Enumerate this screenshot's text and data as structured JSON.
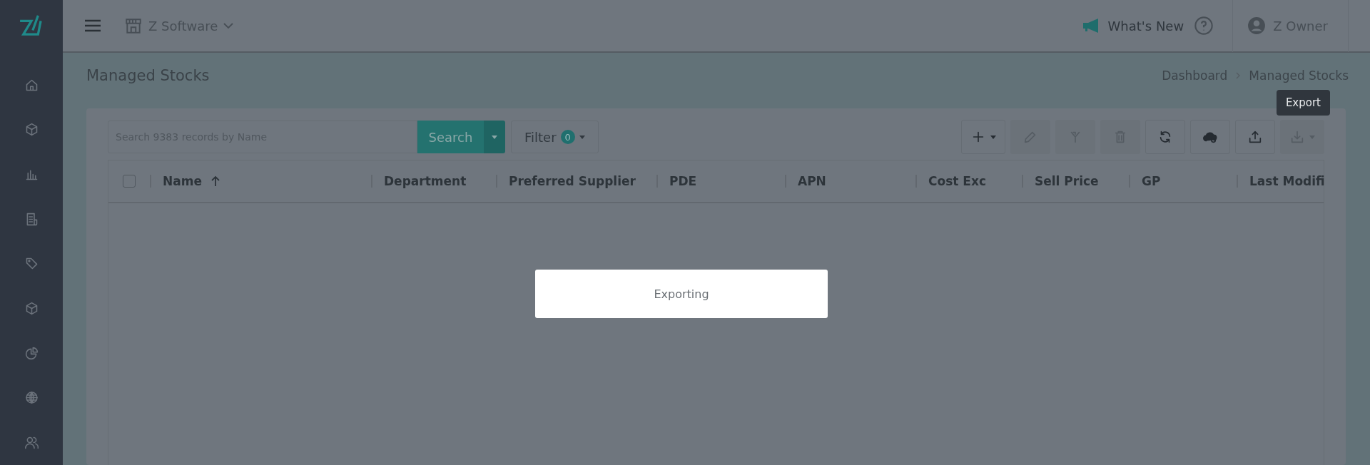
{
  "topbar": {
    "store": "Z Software",
    "whats_new": "What's New",
    "user": "Z Owner"
  },
  "page": {
    "title": "Managed Stocks",
    "breadcrumb": [
      "Dashboard",
      "Managed Stocks"
    ]
  },
  "search": {
    "placeholder": "Search 9383 records by Name",
    "button": "Search"
  },
  "filter": {
    "label": "Filter",
    "count": "0"
  },
  "toolbar": [
    {
      "disabled": false
    },
    {
      "disabled": true
    },
    {
      "disabled": true
    },
    {
      "disabled": true
    },
    {
      "disabled": false
    },
    {
      "disabled": false
    },
    {
      "disabled": false
    },
    {
      "disabled": true
    }
  ],
  "tooltip": "Export",
  "table": {
    "select_all_checked": false,
    "columns": [
      {
        "label": "Name",
        "sorted": true
      },
      {
        "label": "Department",
        "sorted": false
      },
      {
        "label": "Preferred Supplier",
        "sorted": false
      },
      {
        "label": "PDE",
        "sorted": false
      },
      {
        "label": "APN",
        "sorted": false
      },
      {
        "label": "Cost Exc",
        "sorted": false
      },
      {
        "label": "Sell Price",
        "sorted": false
      },
      {
        "label": "GP",
        "sorted": false
      },
      {
        "label": "Last Modifi",
        "sorted": false
      }
    ]
  },
  "modal": {
    "message": "Exporting"
  }
}
